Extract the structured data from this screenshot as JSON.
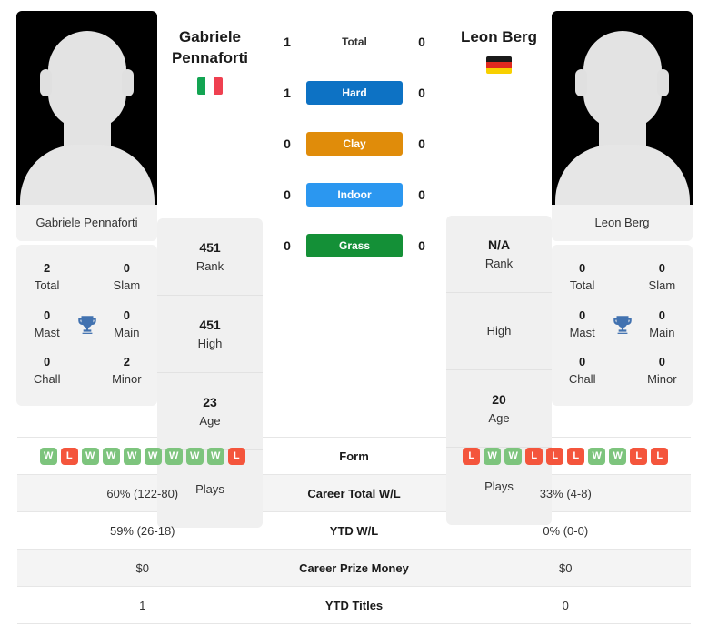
{
  "players": {
    "left": {
      "first_name": "Gabriele",
      "last_name": "Pennaforti",
      "full_name": "Gabriele Pennaforti",
      "flag_name": "italy-flag",
      "flag_colors": [
        "#13a452",
        "#ffffff",
        "#ef4050"
      ],
      "flag_orientation": "vertical",
      "rank": "451",
      "rank_label": "Rank",
      "high": "451",
      "high_label": "High",
      "age": "23",
      "age_label": "Age",
      "plays": "",
      "plays_label": "Plays",
      "titles": {
        "total": "2",
        "total_label": "Total",
        "slam": "0",
        "slam_label": "Slam",
        "mast": "0",
        "mast_label": "Mast",
        "main": "0",
        "main_label": "Main",
        "chall": "0",
        "chall_label": "Chall",
        "minor": "2",
        "minor_label": "Minor"
      },
      "form": [
        "W",
        "L",
        "W",
        "W",
        "W",
        "W",
        "W",
        "W",
        "W",
        "L"
      ],
      "career_total_wl": "60% (122-80)",
      "ytd_wl": "59% (26-18)",
      "career_prize_money": "$0",
      "ytd_titles": "1"
    },
    "right": {
      "first_name": "Leon",
      "last_name": "Berg",
      "full_name": "Leon Berg",
      "flag_name": "germany-flag",
      "flag_colors": [
        "#1a1a1a",
        "#e0291f",
        "#f8d000"
      ],
      "flag_orientation": "horizontal",
      "rank": "N/A",
      "rank_label": "Rank",
      "high": "",
      "high_label": "High",
      "age": "20",
      "age_label": "Age",
      "plays": "",
      "plays_label": "Plays",
      "titles": {
        "total": "0",
        "total_label": "Total",
        "slam": "0",
        "slam_label": "Slam",
        "mast": "0",
        "mast_label": "Mast",
        "main": "0",
        "main_label": "Main",
        "chall": "0",
        "chall_label": "Chall",
        "minor": "0",
        "minor_label": "Minor"
      },
      "form": [
        "L",
        "W",
        "W",
        "L",
        "L",
        "L",
        "W",
        "W",
        "L",
        "L"
      ],
      "career_total_wl": "33% (4-8)",
      "ytd_wl": "0% (0-0)",
      "career_prize_money": "$0",
      "ytd_titles": "0"
    }
  },
  "head_to_head": [
    {
      "label": "Total",
      "left": "1",
      "right": "0",
      "color": "",
      "text_color": "#333333"
    },
    {
      "label": "Hard",
      "left": "1",
      "right": "0",
      "color": "#0d72c4",
      "text_color": "#ffffff"
    },
    {
      "label": "Clay",
      "left": "0",
      "right": "0",
      "color": "#e08c0a",
      "text_color": "#ffffff"
    },
    {
      "label": "Indoor",
      "left": "0",
      "right": "0",
      "color": "#2b97f0",
      "text_color": "#ffffff"
    },
    {
      "label": "Grass",
      "left": "0",
      "right": "0",
      "color": "#149037",
      "text_color": "#ffffff"
    }
  ],
  "stat_rows": [
    {
      "label": "Form",
      "type": "form"
    },
    {
      "label": "Career Total W/L",
      "type": "text",
      "key": "career_total_wl"
    },
    {
      "label": "YTD W/L",
      "type": "text",
      "key": "ytd_wl"
    },
    {
      "label": "Career Prize Money",
      "type": "text",
      "key": "career_prize_money"
    },
    {
      "label": "YTD Titles",
      "type": "text",
      "key": "ytd_titles"
    }
  ],
  "icons": {
    "trophy": "trophy-icon"
  },
  "colors": {
    "win_badge": "#7dc47d",
    "loss_badge": "#f4553c",
    "card_bg": "#f2f2f2",
    "row_alt_bg": "#f4f4f4"
  }
}
